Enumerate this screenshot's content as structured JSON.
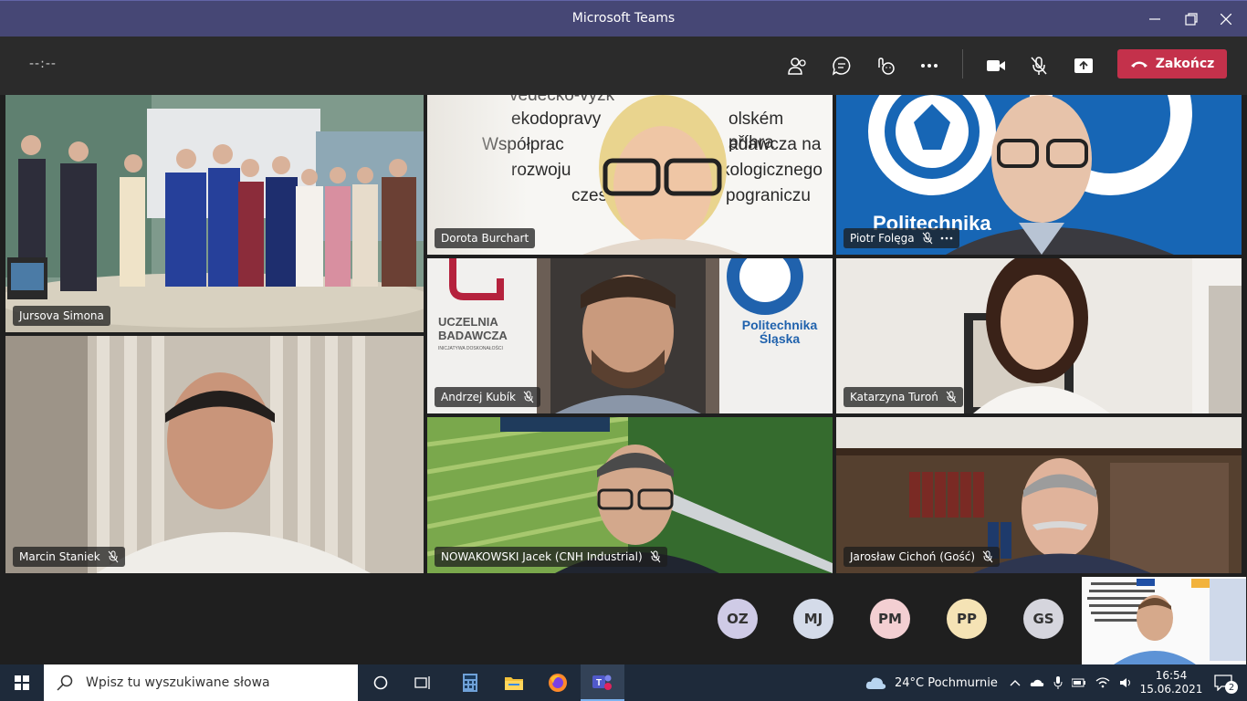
{
  "window": {
    "title": "Microsoft Teams"
  },
  "controls": {
    "timer": "--:--",
    "leave_label": "Zakończ"
  },
  "participants": {
    "jursova": "Jursova Simona",
    "burchart": "Dorota Burchart",
    "folega": "Piotr Folęga",
    "staniek": "Marcin Staniek",
    "kubik": "Andrzej Kubík",
    "turon": "Katarzyna Turoń",
    "nowakowski": "NOWAKOWSKI Jacek (CNH Industrial)",
    "cichon": "Jarosław Cichoń (Gość)"
  },
  "slide_text": {
    "line1": "vedecko-vyzk",
    "line2": "ekodopravy",
    "line2b": "olském příhra",
    "line3": "Współprac",
    "line3b": "adawcza na",
    "line4": "rozwoju",
    "line4b": "kologicznego",
    "line5": "czes",
    "line5b": "pograniczu"
  },
  "backgrounds": {
    "polsl": "Politechnika Śląska",
    "polsl_short": "Politechnika",
    "uczelnia": "UCZELNIA",
    "badawcza": "BADAWCZA",
    "inicjatywa": "INICJATYWA DOSKONAŁOŚCI"
  },
  "avatars": [
    {
      "initials": "OZ",
      "color": "#cfcbe6"
    },
    {
      "initials": "MJ",
      "color": "#d4dbe9"
    },
    {
      "initials": "PM",
      "color": "#f3cfd2"
    },
    {
      "initials": "PP",
      "color": "#f5e3b5"
    },
    {
      "initials": "GS",
      "color": "#d5d5dd"
    }
  ],
  "taskbar": {
    "search_placeholder": "Wpisz tu wyszukiwane słowa",
    "weather": "24°C  Pochmurnie",
    "time": "16:54",
    "date": "15.06.2021",
    "notifications": "2"
  },
  "icons": [
    "people-icon",
    "chat-icon",
    "reactions-icon",
    "more-icon",
    "camera-icon",
    "mic-off-icon",
    "share-icon",
    "phone-icon"
  ]
}
